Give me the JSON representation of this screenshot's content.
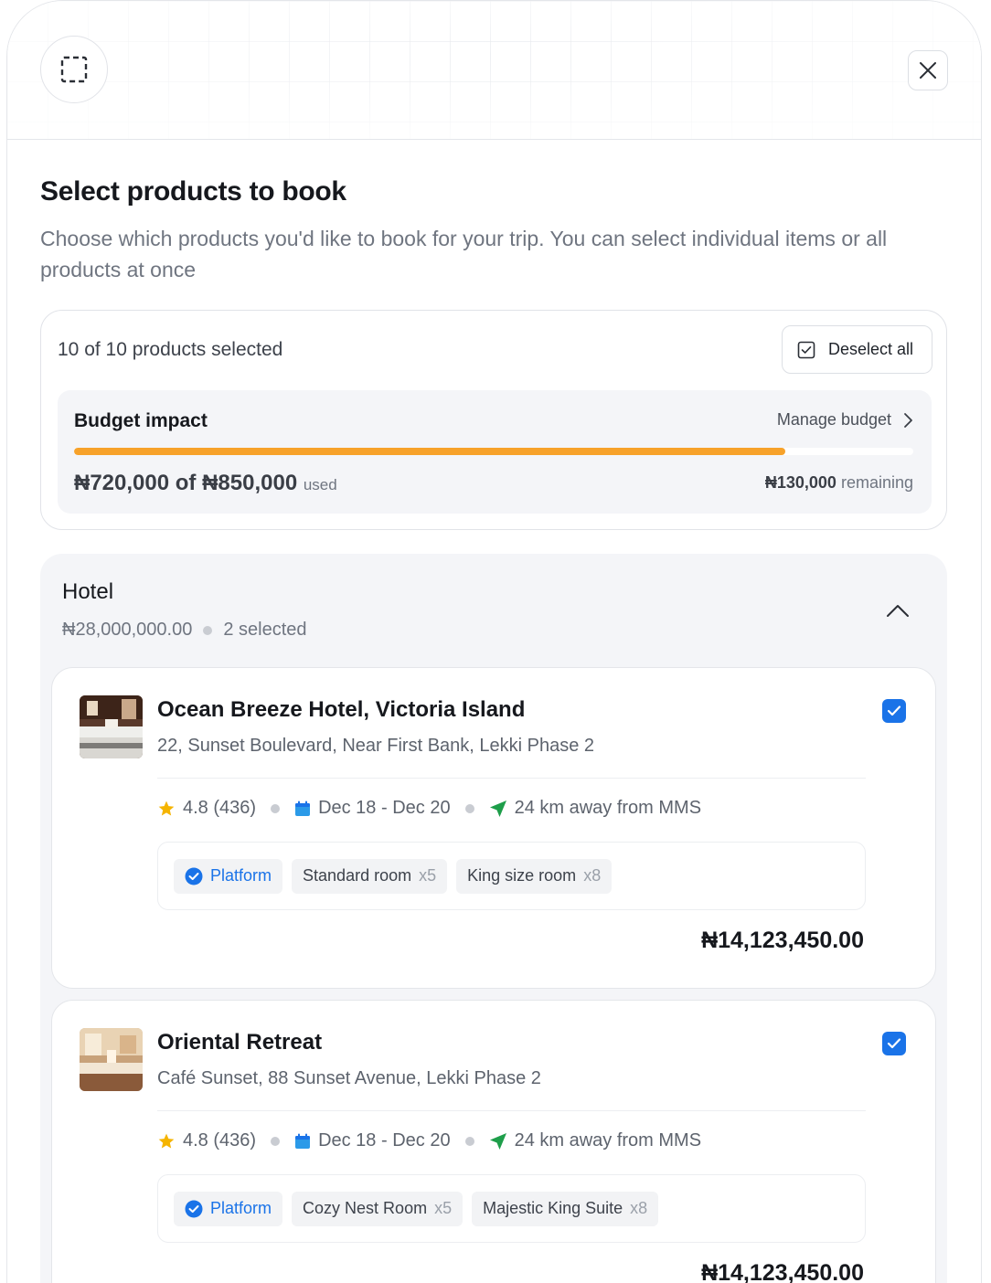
{
  "header": {
    "icon": "select-area-icon",
    "close_icon": "close-icon"
  },
  "page": {
    "title": "Select products to book",
    "subtitle": "Choose which products you'd like to book for your trip. You can select individual items or all products at once"
  },
  "summary": {
    "selected_text": "10 of 10 products selected",
    "deselect_label": "Deselect all",
    "budget": {
      "title": "Budget impact",
      "manage_label": "Manage budget",
      "used_text": "₦720,000 of ₦850,000",
      "used_suffix": "used",
      "remaining_amount": "₦130,000",
      "remaining_suffix": "remaining",
      "used_fraction": 0.847,
      "progress_color": "#f7a22a"
    }
  },
  "section": {
    "title": "Hotel",
    "total": "₦28,000,000.00",
    "selected_text": "2 selected",
    "products": [
      {
        "name": "Ocean Breeze Hotel, Victoria Island",
        "address": "22, Sunset Boulevard, Near First Bank, Lekki Phase 2",
        "rating": "4.8 (436)",
        "dates": "Dec 18 - Dec 20",
        "distance": "24 km away from MMS",
        "platform_label": "Platform",
        "rooms": [
          {
            "name": "Standard room",
            "qty": "x5"
          },
          {
            "name": "King size room",
            "qty": "x8"
          }
        ],
        "price": "₦14,123,450.00",
        "checked": true
      },
      {
        "name": "Oriental Retreat",
        "address": "Café Sunset, 88 Sunset Avenue, Lekki Phase 2",
        "rating": "4.8 (436)",
        "dates": "Dec 18 - Dec 20",
        "distance": "24 km away from MMS",
        "platform_label": "Platform",
        "rooms": [
          {
            "name": "Cozy Nest Room",
            "qty": "x5"
          },
          {
            "name": "Majestic King Suite",
            "qty": "x8"
          }
        ],
        "price": "₦14,123,450.00",
        "checked": true
      }
    ]
  },
  "colors": {
    "accent": "#1a73e8",
    "progress": "#f7a22a",
    "star": "#f5b400",
    "calendar": "#2b9ae8",
    "navigation": "#1e9e4a"
  }
}
